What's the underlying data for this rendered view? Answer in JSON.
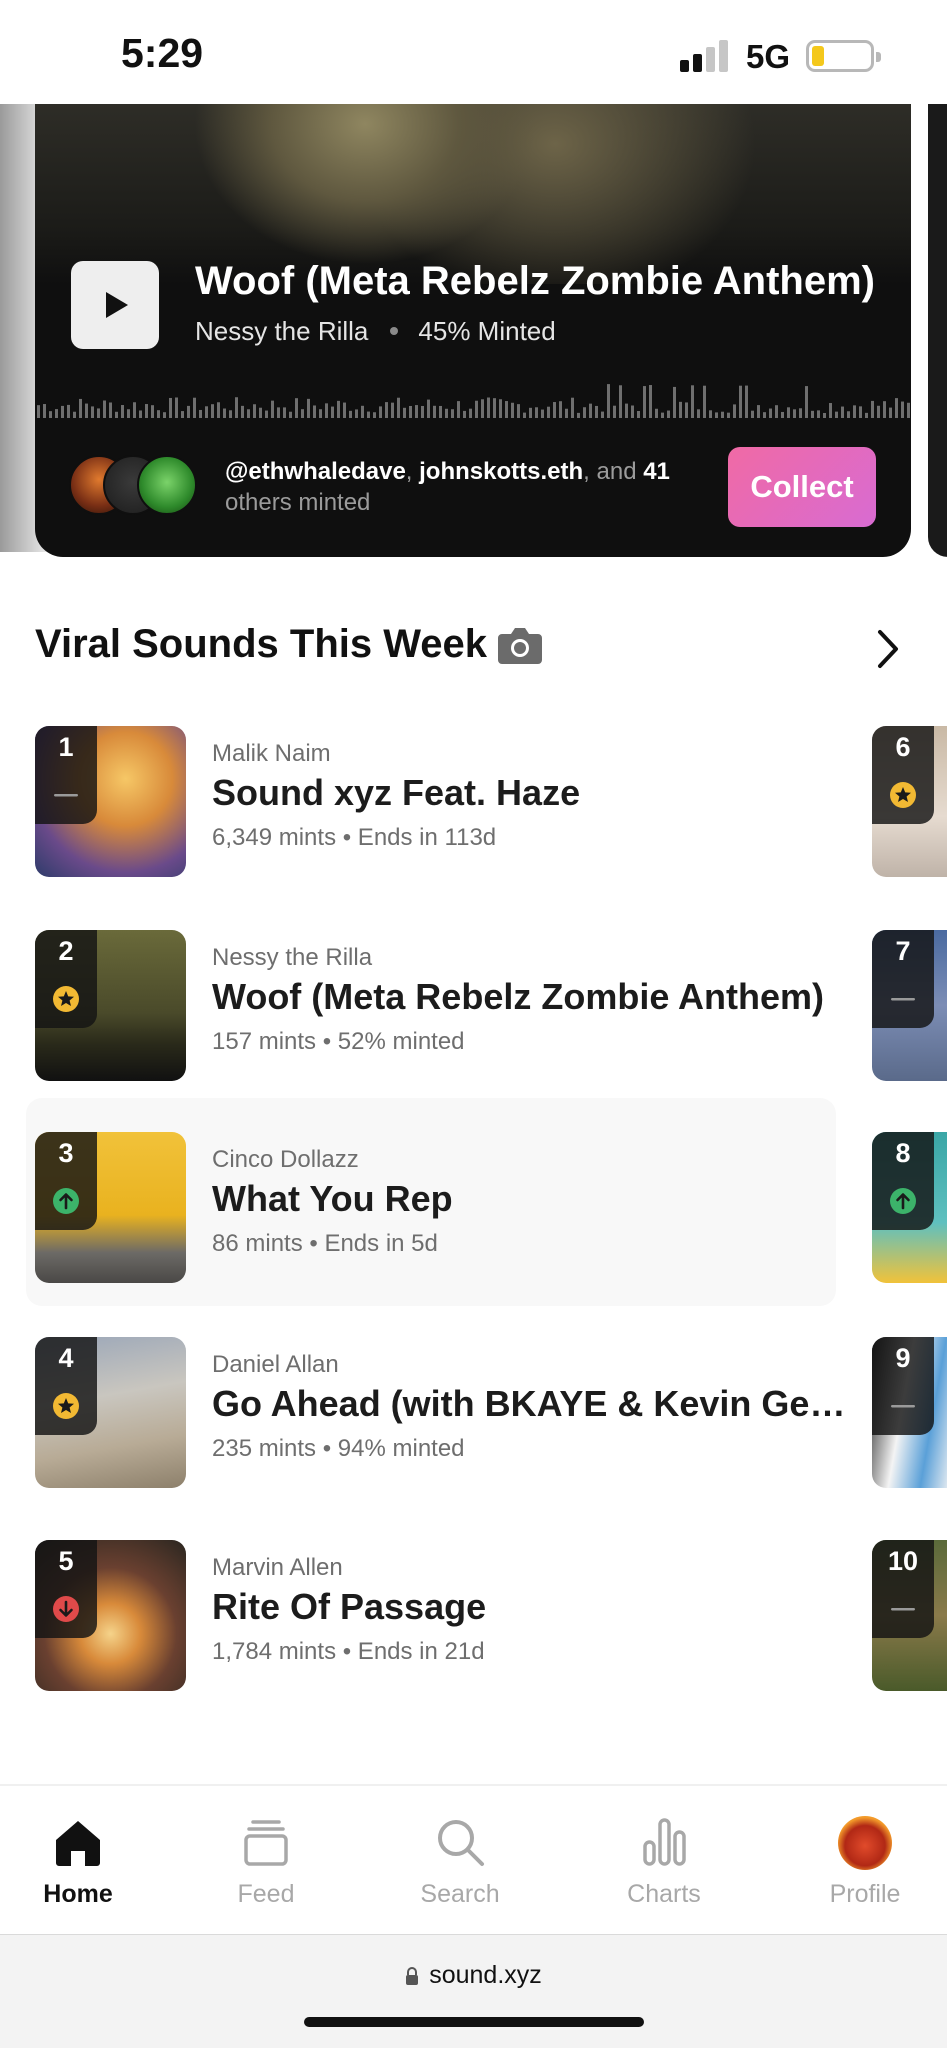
{
  "status_bar": {
    "time": "5:29",
    "network": "5G"
  },
  "hero": {
    "title": "Woof (Meta Rebelz Zombie Anthem)",
    "artist": "Nessy the Rilla",
    "minted": "45% Minted",
    "minters_user1": "@ethwhaledave",
    "minters_sep1": ", ",
    "minters_user2": "johnskotts.eth",
    "minters_sep2": ", and ",
    "minters_count": "41",
    "minters_rest": "others minted",
    "collect_label": "Collect"
  },
  "section": {
    "title": "Viral Sounds This Week"
  },
  "chart": [
    {
      "rank": "1",
      "artist": "Malik Naim",
      "title": "Sound xyz Feat. Haze",
      "meta": "6,349 mints • Ends in 113d",
      "trend": "same"
    },
    {
      "rank": "2",
      "artist": "Nessy the Rilla",
      "title": "Woof (Meta Rebelz Zombie Anthem)",
      "meta": "157 mints • 52% minted",
      "trend": "new"
    },
    {
      "rank": "3",
      "artist": "Cinco Dollazz",
      "title": "What You Rep",
      "meta": "86 mints • Ends in 5d",
      "trend": "up"
    },
    {
      "rank": "4",
      "artist": "Daniel Allan",
      "title": "Go Ahead (with BKAYE & Kevin Geo...",
      "meta": "235 mints • 94% minted",
      "trend": "new"
    },
    {
      "rank": "5",
      "artist": "Marvin Allen",
      "title": "Rite Of Passage",
      "meta": "1,784 mints • Ends in 21d",
      "trend": "down"
    }
  ],
  "side_chart": [
    {
      "rank": "6",
      "trend": "new"
    },
    {
      "rank": "7",
      "trend": "same"
    },
    {
      "rank": "8",
      "trend": "up"
    },
    {
      "rank": "9",
      "trend": "same"
    },
    {
      "rank": "10",
      "trend": "same"
    }
  ],
  "tabs": {
    "home": "Home",
    "feed": "Feed",
    "search": "Search",
    "charts": "Charts",
    "profile": "Profile"
  },
  "browser": {
    "url": "sound.xyz"
  },
  "colors": {
    "collect_gradient_start": "#f06aa5",
    "collect_gradient_end": "#d86bd2",
    "new_star": "#f2b933",
    "up_green": "#3cb36a",
    "down_red": "#e04a4a"
  }
}
